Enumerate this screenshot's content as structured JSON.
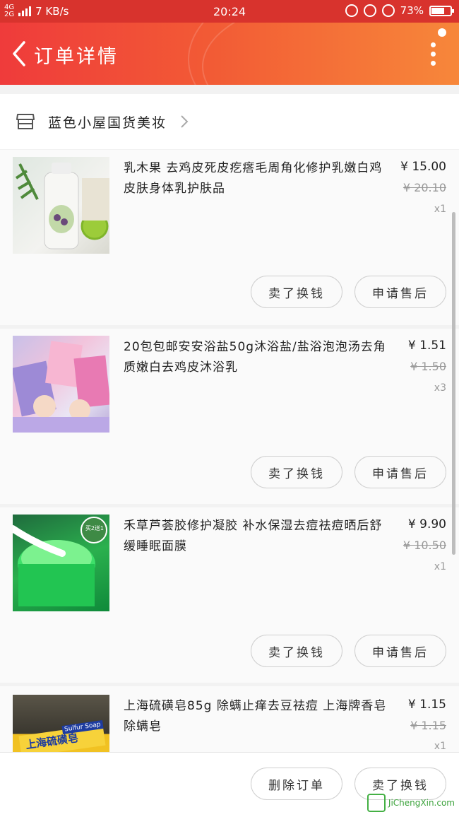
{
  "status_bar": {
    "network": "4G",
    "network2": "2G",
    "speed": "7 KB/s",
    "time": "20:24",
    "battery": "73%",
    "battery_level": 0.73
  },
  "header": {
    "title": "订单详情"
  },
  "shop": {
    "name": "蓝色小屋国货美妆"
  },
  "items": [
    {
      "name": "乳木果 去鸡皮死皮疙瘩毛周角化修护乳嫩白鸡皮肤身体乳护肤品",
      "price": "¥ 15.00",
      "original_price": "¥ 20.10",
      "qty": "x1",
      "btn_left": "卖了换钱",
      "btn_right": "申请售后"
    },
    {
      "name": "20包包邮安安浴盐50g沐浴盐/盐浴泡泡汤去角质嫩白去鸡皮沐浴乳",
      "price": "¥ 1.51",
      "original_price": "¥ 1.50",
      "qty": "x3",
      "btn_left": "卖了换钱",
      "btn_right": "申请售后"
    },
    {
      "name": "禾草芦荟胶修护凝胶 补水保湿去痘祛痘晒后舒缓睡眠面膜",
      "price": "¥ 9.90",
      "original_price": "¥ 10.50",
      "qty": "x1",
      "thumb_badge": "买2送1",
      "btn_left": "卖了换钱",
      "btn_right": "申请售后"
    },
    {
      "name": "上海硫磺皂85g 除螨止痒去豆祛痘 上海牌香皂 除螨皂",
      "price": "¥ 1.15",
      "original_price": "¥ 1.15",
      "qty": "x1",
      "thumb_label": "上海硫磺皂",
      "thumb_label2": "Sulfur Soap"
    }
  ],
  "bottom": {
    "delete_order": "删除订单",
    "sell": "卖了换钱"
  },
  "watermark": {
    "text": "JiChengXin.com"
  }
}
